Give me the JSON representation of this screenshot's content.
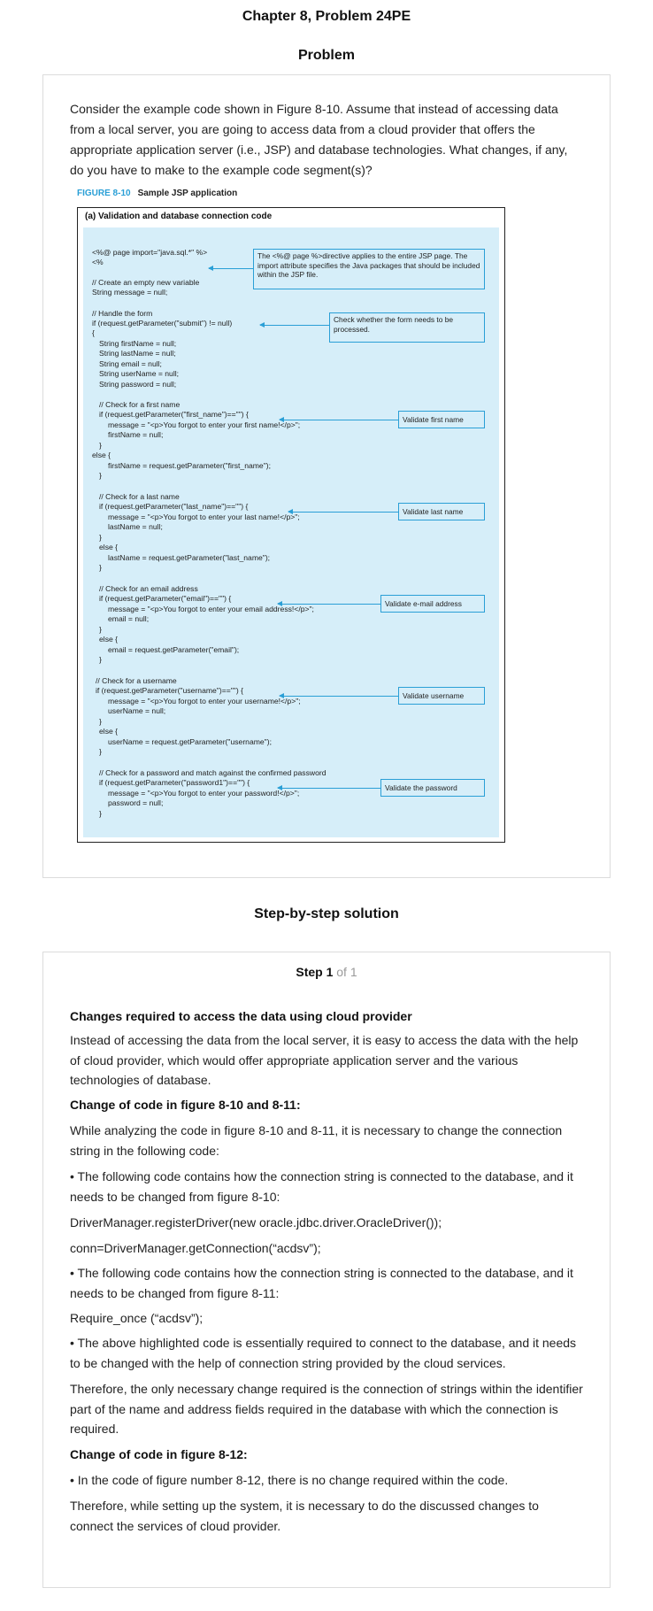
{
  "header": {
    "title": "Chapter 8, Problem 24PE"
  },
  "problem": {
    "heading": "Problem",
    "question": "Consider the example code shown in Figure 8-10. Assume that instead of accessing data from a local server, you are going to access data from a cloud provider that offers the appropriate application server (i.e., JSP) and database technologies. What changes, if any, do you have to make to the example code segment(s)?",
    "figure": {
      "number": "FIGURE 8-10",
      "caption": "Sample JSP application",
      "subtitle": "(a) Validation and database connection code",
      "code_lines": [
        "<%@ page import=\"java.sql.*\" %>",
        "<%",
        "// Create an empty new variable",
        "String message = null;",
        "// Handle the form",
        "if (request.getParameter(\"submit\") != null)",
        "{",
        "String firstName = null;",
        "String lastName = null;",
        "String email = null;",
        "String userName = null;",
        "String password = null;",
        "// Check for a first name",
        "if (request.getParameter(\"first_name\")==\"\") {",
        "message = \"<p>You forgot to enter your first name!</p>\";",
        "firstName = null;",
        "}",
        "else {",
        "firstName = request.getParameter(\"first_name\");",
        "}",
        "// Check for a last name",
        "if (request.getParameter(\"last_name\")==\"\") {",
        "message = \"<p>You forgot to enter your last name!</p>\";",
        "lastName = null;",
        "}",
        "else {",
        "lastName = request.getParameter(\"last_name\");",
        "}",
        "// Check for an email address",
        "if (request.getParameter(\"email\")==\"\") {",
        "message = \"<p>You forgot to enter your email address!</p>\";",
        "email = null;",
        "}",
        "else {",
        "email = request.getParameter(\"email\");",
        "}",
        "// Check for a username",
        "if (request.getParameter(\"username\")==\"\") {",
        "message = \"<p>You forgot to enter your username!</p>\";",
        "userName = null;",
        "}",
        "else {",
        "userName = request.getParameter(\"username\");",
        "}",
        "// Check for a password and match against the confirmed password",
        "if (request.getParameter(\"password1\")==\"\") {",
        "message = \"<p>You forgot to enter your password!</p>\";",
        "password = null;",
        "}"
      ],
      "callouts": [
        "The <%@ page %>directive applies to the entire JSP page. The import attribute specifies the Java packages that should be included within the JSP file.",
        "Check whether the form needs to be processed.",
        "Validate first name",
        "Validate last name",
        "Validate e-mail address",
        "Validate username",
        "Validate the password"
      ]
    }
  },
  "solution": {
    "heading": "Step-by-step solution",
    "step_label": "Step 1",
    "step_of": "of 1",
    "paragraphs": [
      "Changes required to access the data using cloud provider",
      "Instead of accessing the data from the local server, it is easy to access the data with the help of cloud provider, which would offer appropriate application server and the various technologies of database.",
      "Change of code in figure 8-10 and 8-11:",
      "While analyzing the code in figure 8-10 and 8-11, it is necessary to change the connection string in the following code:",
      "• The following code contains how the connection string is connected to the database, and it needs to be changed from figure 8-10:",
      "DriverManager.registerDriver(new oracle.jdbc.driver.OracleDriver());",
      "conn=DriverManager.getConnection(“acdsv”);",
      "• The following code contains how the connection string is connected to the database, and it needs to be changed from figure 8-11:",
      "Require_once (“acdsv”);",
      "• The above highlighted code is essentially required to connect to the database, and it needs to be changed with the help of connection string provided by the cloud services.",
      "Therefore, the only necessary change required is the connection of strings within the identifier part of the name and address fields required in the database with which the connection is required.",
      "Change of code in figure 8-12:",
      "• In the code of figure number 8-12, there is no change required within the code.",
      "Therefore, while setting up the system, it is necessary to do the discussed changes to connect the services of cloud provider."
    ]
  }
}
